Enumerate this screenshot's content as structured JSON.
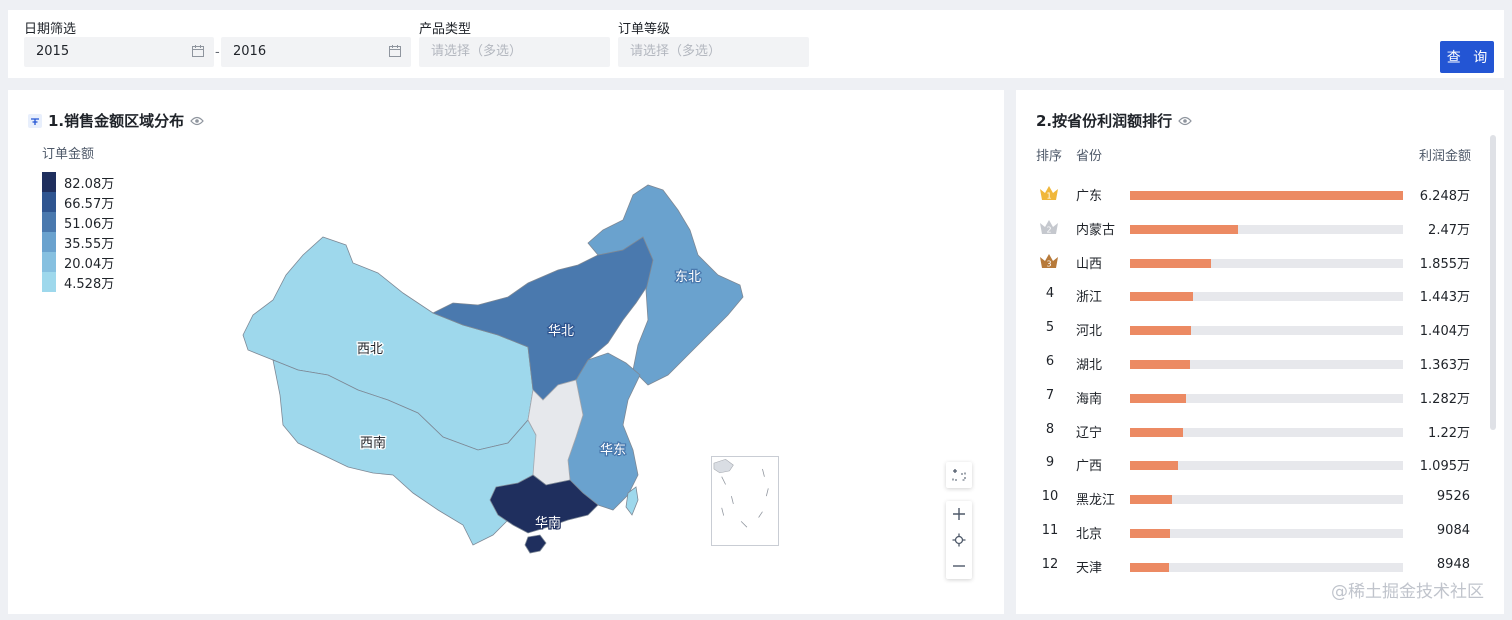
{
  "filters": {
    "date_label": "日期筛选",
    "date_start": "2015",
    "date_end": "2016",
    "date_sep": "-",
    "product_label": "产品类型",
    "product_placeholder": "请选择（多选）",
    "level_label": "订单等级",
    "level_placeholder": "请选择（多选）",
    "query_button": "查 询"
  },
  "map_panel": {
    "title": "1.销售金额区域分布",
    "legend_title": "订单金额",
    "legend": [
      {
        "label": "82.08万",
        "color": "#1f2f5e"
      },
      {
        "label": "66.57万",
        "color": "#2f5590"
      },
      {
        "label": "51.06万",
        "color": "#4a79ae"
      },
      {
        "label": "35.55万",
        "color": "#6aa2ce"
      },
      {
        "label": "20.04万",
        "color": "#86c0e0"
      },
      {
        "label": "4.528万",
        "color": "#9ed8ec"
      }
    ],
    "regions": [
      {
        "label": "西北",
        "color": "#9ed8ec"
      },
      {
        "label": "西南",
        "color": "#9ed8ec"
      },
      {
        "label": "华北",
        "color": "#4a79ae"
      },
      {
        "label": "东北",
        "color": "#6aa2ce"
      },
      {
        "label": "华东",
        "color": "#6aa2ce"
      },
      {
        "label": "华南",
        "color": "#1f2f5e"
      }
    ]
  },
  "rank_panel": {
    "title": "2.按省份利润额排行",
    "col_rank": "排序",
    "col_province": "省份",
    "col_profit": "利润金额",
    "max_value": 62480,
    "rows": [
      {
        "rank": "1",
        "province": "广东",
        "value_text": "6.248万",
        "value": 62480
      },
      {
        "rank": "2",
        "province": "内蒙古",
        "value_text": "2.47万",
        "value": 24700
      },
      {
        "rank": "3",
        "province": "山西",
        "value_text": "1.855万",
        "value": 18550
      },
      {
        "rank": "4",
        "province": "浙江",
        "value_text": "1.443万",
        "value": 14430
      },
      {
        "rank": "5",
        "province": "河北",
        "value_text": "1.404万",
        "value": 14040
      },
      {
        "rank": "6",
        "province": "湖北",
        "value_text": "1.363万",
        "value": 13630
      },
      {
        "rank": "7",
        "province": "海南",
        "value_text": "1.282万",
        "value": 12820
      },
      {
        "rank": "8",
        "province": "辽宁",
        "value_text": "1.22万",
        "value": 12200
      },
      {
        "rank": "9",
        "province": "广西",
        "value_text": "1.095万",
        "value": 10950
      },
      {
        "rank": "10",
        "province": "黑龙江",
        "value_text": "9526",
        "value": 9526
      },
      {
        "rank": "11",
        "province": "北京",
        "value_text": "9084",
        "value": 9084
      },
      {
        "rank": "12",
        "province": "天津",
        "value_text": "8948",
        "value": 8948
      }
    ]
  },
  "watermark": "@稀土掘金技术社区",
  "colors": {
    "accent": "#2355d4",
    "bar": "#ec8a63",
    "gold": "#f0b73b",
    "silver": "#c5c8ce",
    "bronze": "#b77a3a"
  }
}
